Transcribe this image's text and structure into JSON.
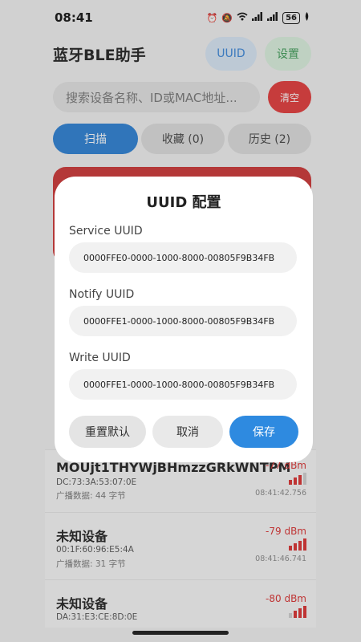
{
  "status_bar": {
    "time": "08:41",
    "battery": "56"
  },
  "header": {
    "title": "蓝牙BLE助手",
    "uuid_button": "UUID",
    "settings_button": "设置"
  },
  "search": {
    "placeholder": "搜索设备名称、ID或MAC地址...",
    "clear_button": "清空"
  },
  "tabs": [
    {
      "label": "扫描",
      "active": true
    },
    {
      "label": "收藏 (0)",
      "active": false
    },
    {
      "label": "历史 (2)",
      "active": false
    }
  ],
  "devices": [
    {
      "name": "MOUjt1THYWjBHmzzGRkWNTPM",
      "mac": "DC:73:3A:53:07:0E",
      "adv": "广播数据: 44 字节",
      "rssi": "-77 dBm",
      "time": "08:41:42.756",
      "bars": 3
    },
    {
      "name": "未知设备",
      "mac": "00:1F:60:96:E5:4A",
      "adv": "广播数据: 31 字节",
      "rssi": "-79 dBm",
      "time": "08:41:46.741",
      "bars": 4
    },
    {
      "name": "未知设备",
      "mac": "DA:31:E3:CE:8D:0E",
      "adv": "",
      "rssi": "-80 dBm",
      "time": "",
      "bars": 3
    }
  ],
  "dialog": {
    "title": "UUID 配置",
    "service_label": "Service UUID",
    "service_value": "0000FFE0-0000-1000-8000-00805F9B34FB",
    "notify_label": "Notify UUID",
    "notify_value": "0000FFE1-0000-1000-8000-00805F9B34FB",
    "write_label": "Write UUID",
    "write_value": "0000FFE1-0000-1000-8000-00805F9B34FB",
    "reset_button": "重置默认",
    "cancel_button": "取消",
    "save_button": "保存"
  },
  "colors": {
    "primary": "#2e8ae0",
    "danger": "#e23a3a",
    "success": "#3e9c57"
  },
  "icons": [
    "alarm-icon",
    "mute-icon",
    "wifi-icon",
    "signal-icon",
    "battery-icon",
    "leaf-icon"
  ]
}
